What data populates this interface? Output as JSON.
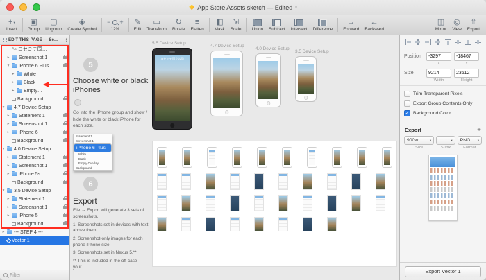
{
  "colors": {
    "accent_blue": "#2676e4",
    "annotation_red": "#ff2d20",
    "folder_blue": "#5fa4ea",
    "canvas_gray": "#e9e9e9"
  },
  "window": {
    "title": "App Store Assets.sketch — Edited"
  },
  "toolbar": {
    "items": [
      {
        "id": "insert",
        "label": "Insert",
        "icon": "plus-icon",
        "glyph": "+",
        "caret": true
      },
      {
        "id": "group",
        "label": "Group",
        "icon": "group-icon",
        "glyph": "▣"
      },
      {
        "id": "ungroup",
        "label": "Ungroup",
        "icon": "ungroup-icon",
        "glyph": "▢"
      },
      {
        "id": "create-symbol",
        "label": "Create Symbol",
        "icon": "symbol-icon",
        "glyph": "◈"
      },
      {
        "id": "zoom",
        "label": "12%",
        "zoom": true
      },
      {
        "id": "edit",
        "label": "Edit",
        "icon": "pencil-icon",
        "glyph": "✎"
      },
      {
        "id": "transform",
        "label": "Transform",
        "icon": "transform-icon",
        "glyph": "▭"
      },
      {
        "id": "rotate",
        "label": "Rotate",
        "icon": "rotate-icon",
        "glyph": "↻"
      },
      {
        "id": "flatten",
        "label": "Flatten",
        "icon": "flatten-icon",
        "glyph": "≡"
      },
      {
        "id": "mask",
        "label": "Mask",
        "icon": "mask-icon",
        "glyph": "◧"
      },
      {
        "id": "scale",
        "label": "Scale",
        "icon": "scale-icon",
        "glyph": "⇲"
      },
      {
        "id": "union",
        "label": "Union",
        "icon": "union-icon",
        "bool": "ic-union"
      },
      {
        "id": "subtract",
        "label": "Subtract",
        "icon": "subtract-icon",
        "bool": "ic-subtract"
      },
      {
        "id": "intersect",
        "label": "Intersect",
        "icon": "intersect-icon",
        "bool": "ic-intersect"
      },
      {
        "id": "difference",
        "label": "Difference",
        "icon": "difference-icon",
        "bool": "ic-difference"
      },
      {
        "id": "forward",
        "label": "Forward",
        "icon": "forward-icon",
        "glyph": "→"
      },
      {
        "id": "backward",
        "label": "Backward",
        "icon": "backward-icon",
        "glyph": "←"
      },
      {
        "id": "mirror",
        "label": "Mirror",
        "icon": "mirror-icon",
        "glyph": "◫",
        "right": true
      },
      {
        "id": "view",
        "label": "View",
        "icon": "view-icon",
        "glyph": "◎"
      },
      {
        "id": "export",
        "label": "Export",
        "icon": "export-icon",
        "glyph": "⇧"
      }
    ]
  },
  "sidebar": {
    "page_selector": "EDIT THIS PAGE — Se…",
    "filter_placeholder": "Filter",
    "layers": [
      {
        "label": "ヨセミテ国…",
        "icon": "text",
        "indent": 1
      },
      {
        "label": "Screenshot 1",
        "icon": "folder",
        "indent": 1,
        "locked": true,
        "disclosure": "collapsed"
      },
      {
        "label": "iPhone 6 Plus",
        "icon": "folder",
        "indent": 1,
        "locked": true,
        "disclosure": "expanded"
      },
      {
        "label": "White",
        "icon": "folder",
        "indent": 2,
        "disclosure": "collapsed"
      },
      {
        "label": "Black",
        "icon": "folder",
        "indent": 2,
        "disclosure": "collapsed"
      },
      {
        "label": "Empty…",
        "icon": "folder",
        "indent": 2,
        "disclosure": "collapsed"
      },
      {
        "label": "Background",
        "icon": "shape",
        "indent": 1,
        "locked": true
      },
      {
        "label": "4.7 Device Setup",
        "icon": "folder",
        "indent": 0,
        "disclosure": "expanded",
        "header": true
      },
      {
        "label": "Statement 1",
        "icon": "folder",
        "indent": 1,
        "locked": true,
        "disclosure": "collapsed"
      },
      {
        "label": "Screenshot 1",
        "icon": "folder",
        "indent": 1,
        "locked": true,
        "disclosure": "collapsed"
      },
      {
        "label": "iPhone 6",
        "icon": "folder",
        "indent": 1,
        "locked": true,
        "disclosure": "collapsed"
      },
      {
        "label": "Background",
        "icon": "shape",
        "indent": 1,
        "locked": true
      },
      {
        "label": "4.0 Device Setup",
        "icon": "folder",
        "indent": 0,
        "disclosure": "expanded",
        "header": true
      },
      {
        "label": "Statement 1",
        "icon": "folder",
        "indent": 1,
        "locked": true,
        "disclosure": "collapsed"
      },
      {
        "label": "Screenshot 1",
        "icon": "folder",
        "indent": 1,
        "locked": true,
        "disclosure": "collapsed"
      },
      {
        "label": "iPhone 5s",
        "icon": "folder",
        "indent": 1,
        "locked": true,
        "disclosure": "collapsed"
      },
      {
        "label": "Background",
        "icon": "shape",
        "indent": 1,
        "locked": true
      },
      {
        "label": "3.5 Device Setup",
        "icon": "folder",
        "indent": 0,
        "disclosure": "expanded",
        "header": true
      },
      {
        "label": "Statement 1",
        "icon": "folder",
        "indent": 1,
        "locked": true,
        "disclosure": "collapsed"
      },
      {
        "label": "Screenshot 1",
        "icon": "folder",
        "indent": 1,
        "locked": true,
        "disclosure": "collapsed"
      },
      {
        "label": "iPhone 5",
        "icon": "folder",
        "indent": 1,
        "locked": true,
        "disclosure": "collapsed"
      },
      {
        "label": "Background",
        "icon": "shape",
        "indent": 1,
        "locked": true
      },
      {
        "label": "--- STEP 4 ---",
        "icon": "folder",
        "indent": 0,
        "disclosure": "collapsed"
      },
      {
        "label": "Vector 1",
        "icon": "vector",
        "indent": 0,
        "selected": true
      }
    ],
    "annotations": {
      "red_box_start": 0,
      "red_box_end": 21,
      "arrow_layer": 4
    }
  },
  "canvas": {
    "step5": {
      "number": "5",
      "title": "Choose white or black iPhones",
      "body": "Go into the iPhone group and show / hide the white or black iPhone for each size.",
      "panel_rows": [
        {
          "label": "Statement 1"
        },
        {
          "label": "Screenshot 1"
        },
        {
          "label": "iPhone 6 Plus",
          "selected": true
        },
        {
          "label": "White",
          "indent": 1
        },
        {
          "label": "Black",
          "indent": 1
        },
        {
          "label": "Empty Overlay",
          "indent": 1
        },
        {
          "label": "Background"
        }
      ]
    },
    "step6": {
      "number": "6",
      "title": "Export",
      "lines": [
        "File → Export will generate 3 sets of screenshots.",
        "1. Screenshots set in devices with text above them.",
        "2. Screenshot-only images for each phone iPhone size.",
        "3. Screenshots set in Nexus 5.**",
        "** This is included in the off-case your…"
      ]
    },
    "artboards": [
      {
        "label": "5.5 Device Setup",
        "variant": "black",
        "screen_title": "ヨセミテ国立公園"
      },
      {
        "label": "4.7 Device Setup",
        "variant": "white"
      },
      {
        "label": "4.0 Device Setup",
        "variant": "white"
      },
      {
        "label": "3.5 Device Setup",
        "variant": "white"
      }
    ],
    "export_grid_rows": [
      10,
      10,
      10,
      8
    ]
  },
  "inspector": {
    "position": {
      "label": "Position",
      "x": "-3297",
      "y": "-18467",
      "x_label": "X",
      "y_label": "Y"
    },
    "size": {
      "label": "Size",
      "width": "9214",
      "height": "23612",
      "width_label": "Width",
      "height_label": "Height"
    },
    "checkboxes": [
      {
        "label": "Trim Transparent Pixels",
        "checked": false
      },
      {
        "label": "Export Group Contents Only",
        "checked": false
      },
      {
        "label": "Background Color",
        "checked": true
      }
    ],
    "export_section": {
      "header": "Export",
      "size_value": "900w",
      "suffix_value": "",
      "format_value": "PNG",
      "size_label": "Size",
      "suffix_label": "Suffix",
      "format_label": "Format",
      "button_label": "Export Vector 1"
    }
  }
}
